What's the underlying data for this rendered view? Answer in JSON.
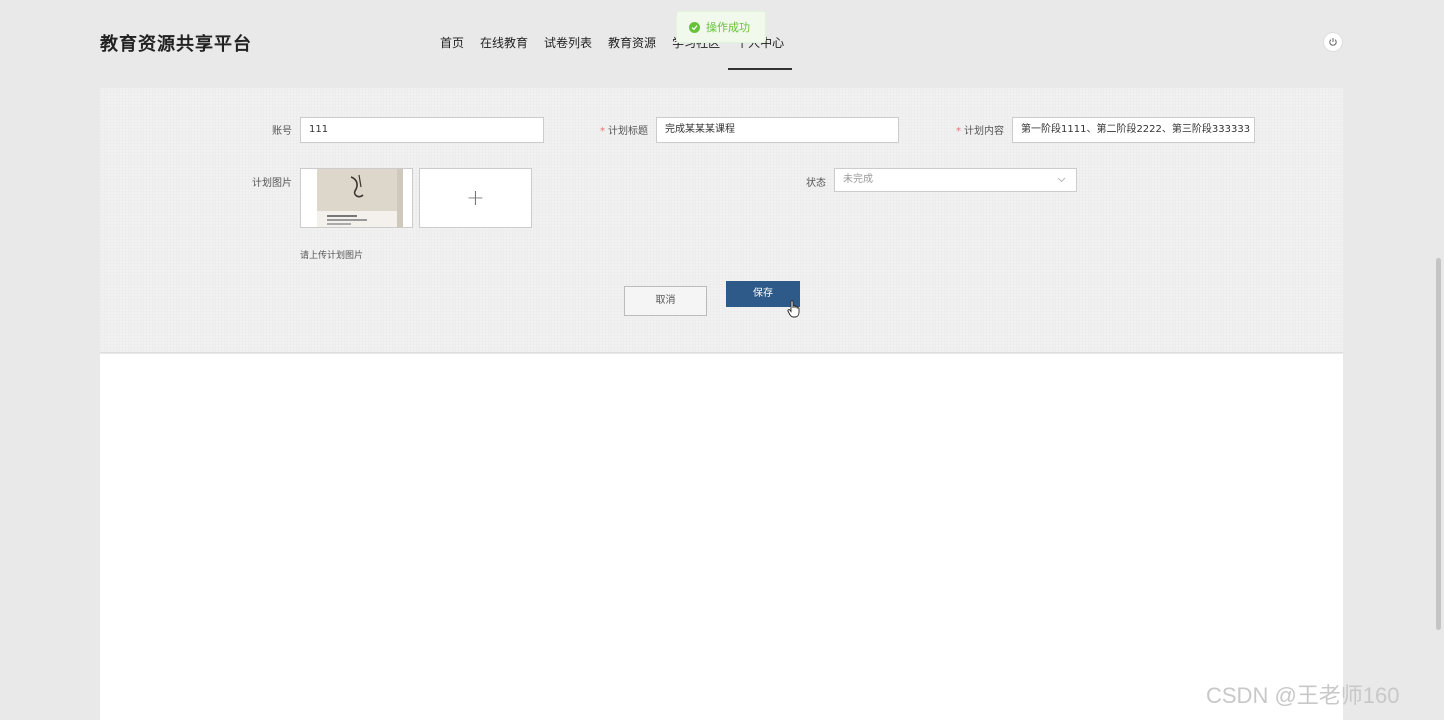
{
  "header": {
    "site_title": "教育资源共享平台",
    "nav": [
      {
        "label": "首页"
      },
      {
        "label": "在线教育"
      },
      {
        "label": "试卷列表"
      },
      {
        "label": "教育资源"
      },
      {
        "label": "学习社区"
      },
      {
        "label": "个人中心"
      }
    ],
    "active_nav": "个人中心"
  },
  "toast": {
    "text": "操作成功",
    "color": "#67c23a"
  },
  "form": {
    "account": {
      "label": "账号",
      "value": "111"
    },
    "plan_title": {
      "label": "计划标题",
      "value": "完成某某某课程",
      "required": true
    },
    "plan_content": {
      "label": "计划内容",
      "value": "第一阶段1111、第二阶段2222、第三阶段333333",
      "required": true
    },
    "plan_image": {
      "label": "计划图片",
      "upload_icon": "plus-icon",
      "hint": "请上传计划图片"
    },
    "status": {
      "label": "状态",
      "placeholder": "未完成",
      "icon": "chevron-down-icon"
    },
    "cancel_label": "取消",
    "save_label": "保存"
  },
  "colors": {
    "save_button": "#2e5a8a",
    "required_mark": "#f56c6c"
  },
  "watermark": "CSDN @王老师160"
}
